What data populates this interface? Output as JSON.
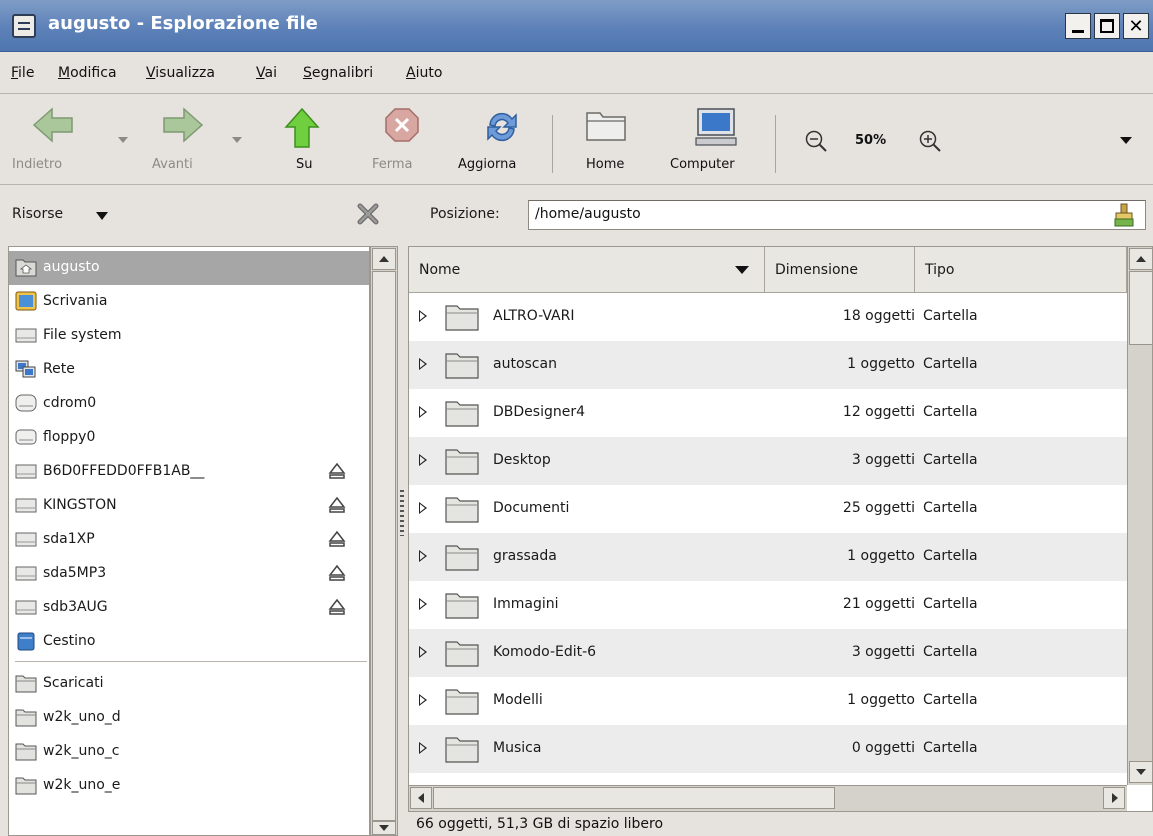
{
  "window": {
    "title": "augusto - Esplorazione file"
  },
  "menubar": {
    "items": [
      "File",
      "Modifica",
      "Visualizza",
      "Vai",
      "Segnalibri",
      "Aiuto"
    ]
  },
  "toolbar": {
    "back_label": "Indietro",
    "forward_label": "Avanti",
    "up_label": "Su",
    "stop_label": "Ferma",
    "reload_label": "Aggiorna",
    "home_label": "Home",
    "computer_label": "Computer",
    "zoom_level": "50%"
  },
  "side_pane": {
    "header_label": "Risorse",
    "items": [
      {
        "label": "augusto",
        "icon": "home-folder-icon",
        "selected": true
      },
      {
        "label": "Scrivania",
        "icon": "desktop-icon"
      },
      {
        "label": "File system",
        "icon": "drive-icon"
      },
      {
        "label": "Rete",
        "icon": "network-icon"
      },
      {
        "label": "cdrom0",
        "icon": "cdrom-icon"
      },
      {
        "label": "floppy0",
        "icon": "floppy-icon"
      },
      {
        "label": "B6D0FFEDD0FFB1AB__",
        "icon": "drive-icon",
        "eject": true
      },
      {
        "label": "KINGSTON",
        "icon": "drive-icon",
        "eject": true
      },
      {
        "label": "sda1XP",
        "icon": "drive-icon",
        "eject": true
      },
      {
        "label": "sda5MP3",
        "icon": "drive-icon",
        "eject": true
      },
      {
        "label": "sdb3AUG",
        "icon": "drive-icon",
        "eject": true
      },
      {
        "label": "Cestino",
        "icon": "trash-icon"
      },
      {
        "label": "Scaricati",
        "icon": "folder-icon"
      },
      {
        "label": "w2k_uno_d",
        "icon": "folder-icon"
      },
      {
        "label": "w2k_uno_c",
        "icon": "folder-icon"
      },
      {
        "label": "w2k_uno_e",
        "icon": "folder-icon"
      }
    ]
  },
  "location": {
    "label": "Posizione:",
    "value": "/home/augusto"
  },
  "filelist": {
    "columns": [
      "Nome",
      "Dimensione",
      "Tipo"
    ],
    "rows": [
      {
        "name": "ALTRO-VARI",
        "size": "18 oggetti",
        "type": "Cartella"
      },
      {
        "name": "autoscan",
        "size": "1 oggetto",
        "type": "Cartella"
      },
      {
        "name": "DBDesigner4",
        "size": "12 oggetti",
        "type": "Cartella"
      },
      {
        "name": "Desktop",
        "size": "3 oggetti",
        "type": "Cartella"
      },
      {
        "name": "Documenti",
        "size": "25 oggetti",
        "type": "Cartella"
      },
      {
        "name": "grassada",
        "size": "1 oggetto",
        "type": "Cartella"
      },
      {
        "name": "Immagini",
        "size": "21 oggetti",
        "type": "Cartella"
      },
      {
        "name": "Komodo-Edit-6",
        "size": "3 oggetti",
        "type": "Cartella"
      },
      {
        "name": "Modelli",
        "size": "1 oggetto",
        "type": "Cartella"
      },
      {
        "name": "Musica",
        "size": "0 oggetti",
        "type": "Cartella"
      }
    ]
  },
  "status": {
    "text": "66 oggetti, 51,3 GB di spazio libero"
  },
  "colors": {
    "titlebar": "#5d81b8",
    "selection": "#a6a6a6",
    "row_alt": "#ececec"
  }
}
